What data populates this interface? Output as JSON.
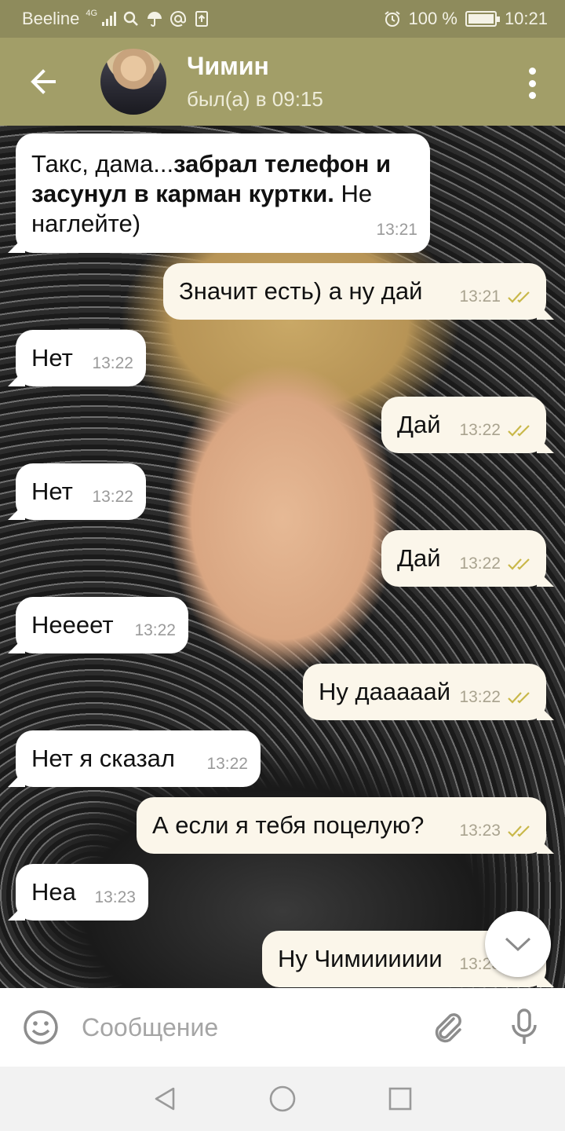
{
  "status_bar": {
    "carrier": "Beeline",
    "network": "4G",
    "battery": "100 %",
    "time": "10:21"
  },
  "header": {
    "back_icon": "arrow-left-icon",
    "contact_name": "Чимин",
    "last_seen": "был(а) в 09:15",
    "menu_icon": "more-vertical-icon"
  },
  "messages": [
    {
      "dir": "in",
      "parts": [
        {
          "t": "Такс, дама...",
          "b": false
        },
        {
          "t": "забрал телефон и засунул в карман куртки.",
          "b": true
        },
        {
          "t": " Не наглейте)",
          "b": false
        }
      ],
      "time": "13:21"
    },
    {
      "dir": "out",
      "text": "Значит есть) а ну дай",
      "time": "13:21"
    },
    {
      "dir": "in",
      "text": "Нет",
      "time": "13:22"
    },
    {
      "dir": "out",
      "text": "Дай",
      "time": "13:22"
    },
    {
      "dir": "in",
      "text": "Нет",
      "time": "13:22"
    },
    {
      "dir": "out",
      "text": "Дай",
      "time": "13:22"
    },
    {
      "dir": "in",
      "text": "Неееет",
      "time": "13:22"
    },
    {
      "dir": "out",
      "text": "Ну дааааай",
      "time": "13:22"
    },
    {
      "dir": "in",
      "text": "Нет я сказал",
      "time": "13:22"
    },
    {
      "dir": "out",
      "text": "А если я тебя поцелую?",
      "time": "13:23"
    },
    {
      "dir": "in",
      "text": "Неа",
      "time": "13:23"
    },
    {
      "dir": "out",
      "text": "Ну Чимииииии",
      "time": "13:23"
    }
  ],
  "input": {
    "placeholder": "Сообщение",
    "emoji_icon": "smiley-icon",
    "attach_icon": "paperclip-icon",
    "mic_icon": "microphone-icon"
  },
  "colors": {
    "header": "#a29e68",
    "status_bar": "#8e8b5c",
    "incoming_bubble": "#ffffff",
    "outgoing_bubble": "#fbf6ea",
    "read_check": "#c9b84a"
  }
}
